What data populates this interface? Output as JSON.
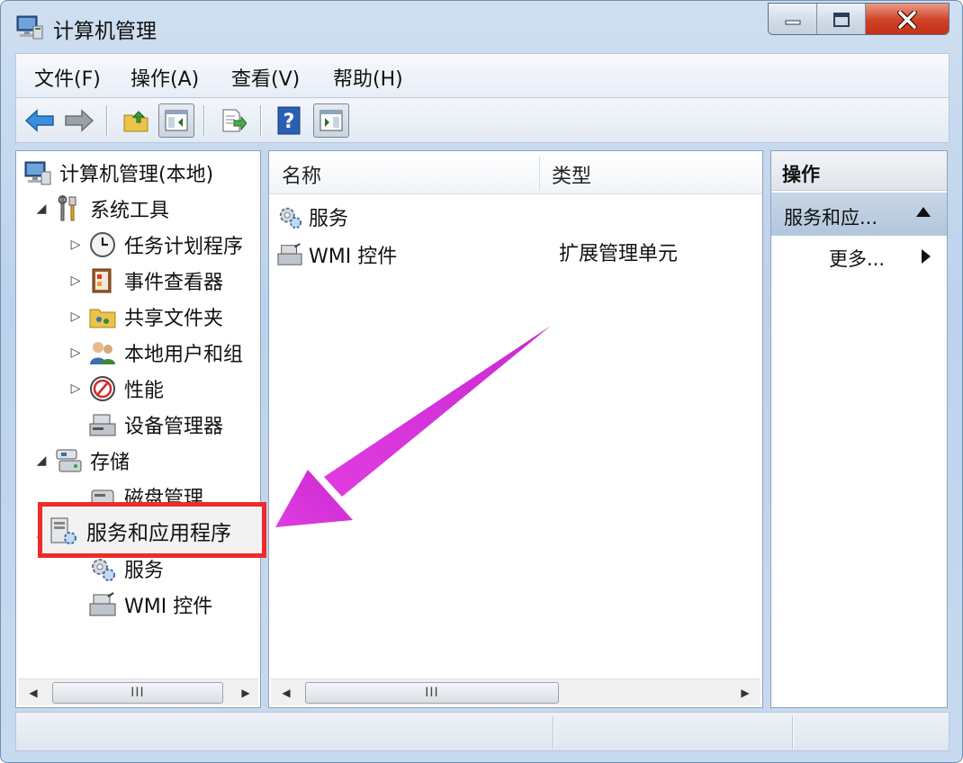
{
  "window": {
    "title": "计算机管理"
  },
  "menubar": {
    "items": [
      "文件(F)",
      "操作(A)",
      "查看(V)",
      "帮助(H)"
    ]
  },
  "toolbar": {
    "buttons": [
      "back-icon",
      "forward-icon",
      "up-folder-icon",
      "show-hide-tree-icon",
      "export-list-icon",
      "help-icon",
      "show-hide-action-pane-icon"
    ]
  },
  "tree": {
    "root": "计算机管理(本地)",
    "system_tools": "系统工具",
    "task_scheduler": "任务计划程序",
    "event_viewer": "事件查看器",
    "shared_folders": "共享文件夹",
    "local_users": "本地用户和组",
    "performance": "性能",
    "device_manager": "设备管理器",
    "storage": "存储",
    "disk_management": "磁盘管理",
    "services_apps": "服务和应用程序",
    "services": "服务",
    "wmi": "WMI 控件"
  },
  "list": {
    "columns": [
      "名称",
      "类型"
    ],
    "rows": [
      {
        "name": "服务",
        "type": ""
      },
      {
        "name": "WMI 控件",
        "type": "扩展管理单元"
      }
    ]
  },
  "actions": {
    "header": "操作",
    "section": "服务和应...",
    "more": "更多..."
  },
  "scroll_thumb_label": "III",
  "colors": {
    "highlight_border": "#ee2b2b",
    "annotation_arrow": "#d63ad6"
  }
}
